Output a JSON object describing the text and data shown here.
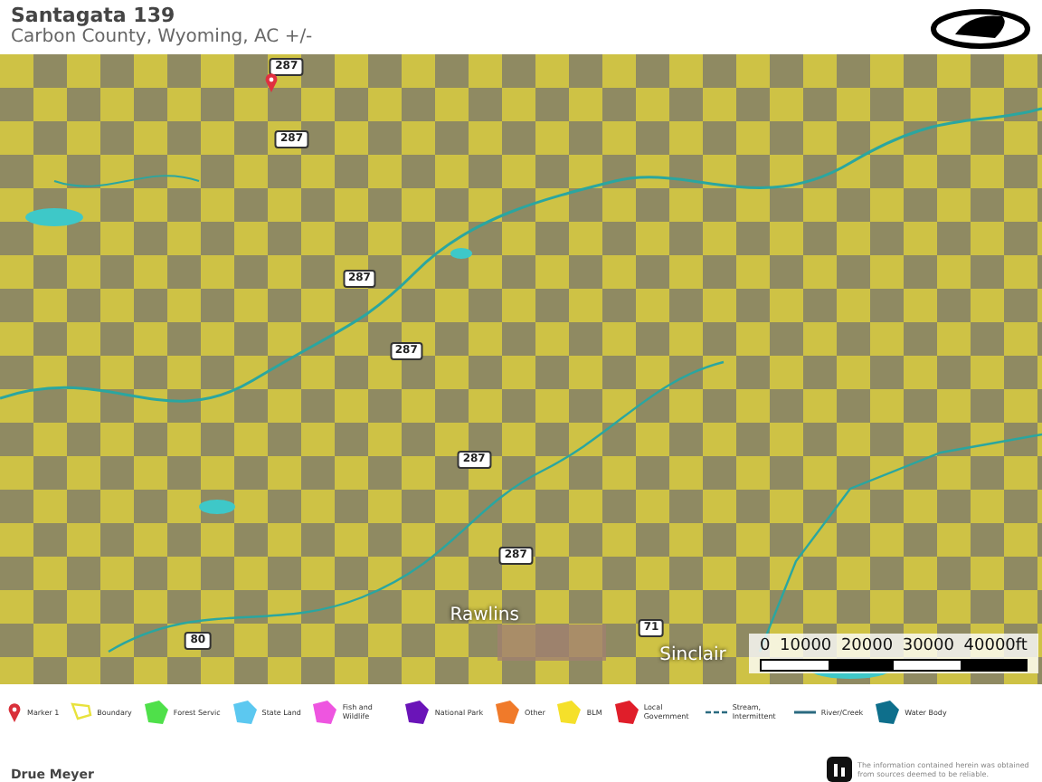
{
  "header": {
    "title": "Santagata 139",
    "subtitle": "Carbon County, Wyoming,  AC +/-"
  },
  "map": {
    "labels": [
      {
        "kind": "shield",
        "text": "287"
      },
      {
        "kind": "shield",
        "text": "287"
      },
      {
        "kind": "shield",
        "text": "287"
      },
      {
        "kind": "shield",
        "text": "287"
      },
      {
        "kind": "shield",
        "text": "287"
      },
      {
        "kind": "shield",
        "text": "287"
      },
      {
        "kind": "shield",
        "text": "80"
      },
      {
        "kind": "shield",
        "text": "71"
      },
      {
        "kind": "town",
        "text": "Rawlins"
      },
      {
        "kind": "town",
        "text": "Sinclair"
      }
    ],
    "scale": {
      "ticks": [
        "0",
        "10000",
        "20000",
        "30000",
        "40000ft"
      ]
    }
  },
  "legend": [
    {
      "kind": "marker",
      "label": "Marker 1",
      "color": "#d9303a"
    },
    {
      "kind": "boundary",
      "label": "Boundary",
      "color": "#e8e23c"
    },
    {
      "kind": "area",
      "label": "Forest Servic",
      "color": "#4fe04a"
    },
    {
      "kind": "area",
      "label": "State Land",
      "color": "#5cc8f0"
    },
    {
      "kind": "area",
      "label": "Fish and Wildlife",
      "color": "#ee55e0"
    },
    {
      "kind": "area",
      "label": "National Park",
      "color": "#6a14b8"
    },
    {
      "kind": "area",
      "label": "Other",
      "color": "#f07a2a"
    },
    {
      "kind": "area",
      "label": "BLM",
      "color": "#f5e02a"
    },
    {
      "kind": "area",
      "label": "Local Government",
      "color": "#e01e2a"
    },
    {
      "kind": "stream",
      "label": "Stream, Intermittent",
      "color": "#2a6a80"
    },
    {
      "kind": "river",
      "label": "River/Creek",
      "color": "#2a6a80"
    },
    {
      "kind": "area",
      "label": "Water Body",
      "color": "#0e6f8c"
    }
  ],
  "footer": {
    "agent": "Drue Meyer",
    "disclaimer": "The information contained herein was obtained from sources deemed to be reliable."
  }
}
